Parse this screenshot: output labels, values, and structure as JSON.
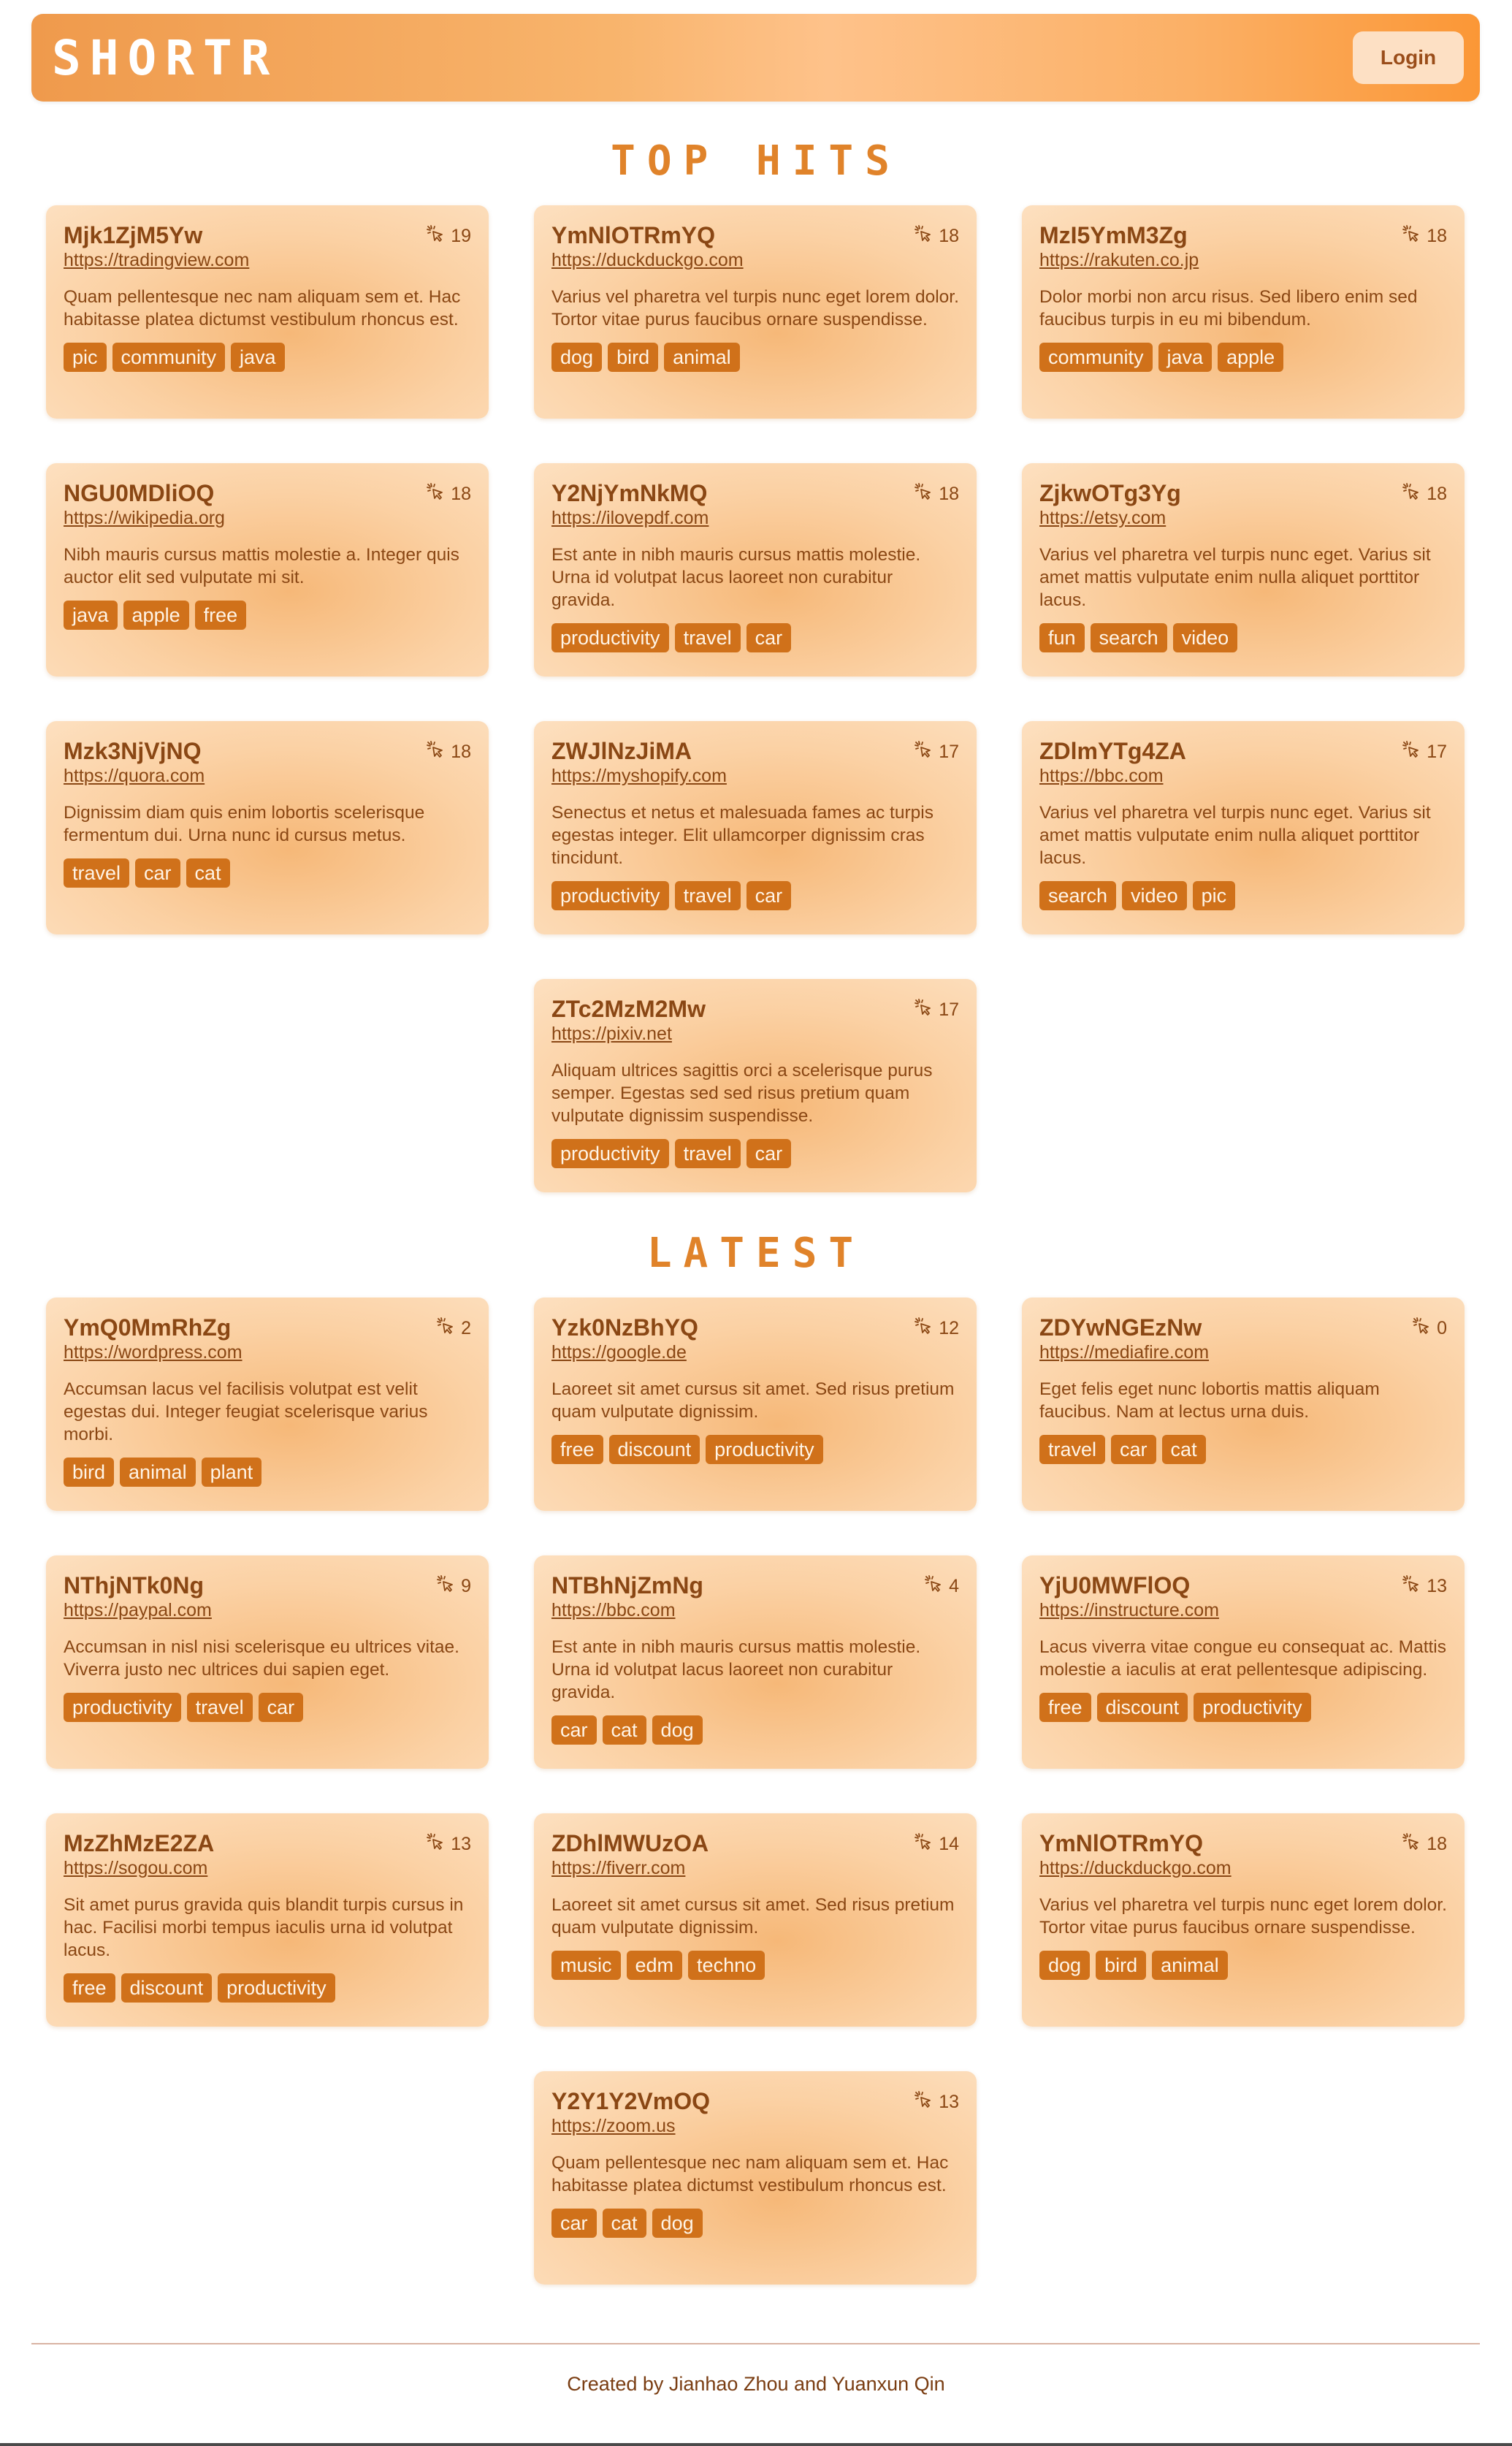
{
  "header": {
    "logo": "SHORTR",
    "login_label": "Login"
  },
  "sections": [
    {
      "title": "TOP HITS",
      "cards": [
        {
          "code": "Mjk1ZjM5Yw",
          "url": "https://tradingview.com",
          "hits": "19",
          "desc": "Quam pellentesque nec nam aliquam sem et. Hac habitasse platea dictumst vestibulum rhoncus est.",
          "tags": [
            "pic",
            "community",
            "java"
          ]
        },
        {
          "code": "YmNlOTRmYQ",
          "url": "https://duckduckgo.com",
          "hits": "18",
          "desc": "Varius vel pharetra vel turpis nunc eget lorem dolor. Tortor vitae purus faucibus ornare suspendisse.",
          "tags": [
            "dog",
            "bird",
            "animal"
          ]
        },
        {
          "code": "MzI5YmM3Zg",
          "url": "https://rakuten.co.jp",
          "hits": "18",
          "desc": "Dolor morbi non arcu risus. Sed libero enim sed faucibus turpis in eu mi bibendum.",
          "tags": [
            "community",
            "java",
            "apple"
          ]
        },
        {
          "code": "NGU0MDliOQ",
          "url": "https://wikipedia.org",
          "hits": "18",
          "desc": "Nibh mauris cursus mattis molestie a. Integer quis auctor elit sed vulputate mi sit.",
          "tags": [
            "java",
            "apple",
            "free"
          ]
        },
        {
          "code": "Y2NjYmNkMQ",
          "url": "https://ilovepdf.com",
          "hits": "18",
          "desc": "Est ante in nibh mauris cursus mattis molestie. Urna id volutpat lacus laoreet non curabitur gravida.",
          "tags": [
            "productivity",
            "travel",
            "car"
          ]
        },
        {
          "code": "ZjkwOTg3Yg",
          "url": "https://etsy.com",
          "hits": "18",
          "desc": "Varius vel pharetra vel turpis nunc eget. Varius sit amet mattis vulputate enim nulla aliquet porttitor lacus.",
          "tags": [
            "fun",
            "search",
            "video"
          ]
        },
        {
          "code": "Mzk3NjVjNQ",
          "url": "https://quora.com",
          "hits": "18",
          "desc": "Dignissim diam quis enim lobortis scelerisque fermentum dui. Urna nunc id cursus metus.",
          "tags": [
            "travel",
            "car",
            "cat"
          ]
        },
        {
          "code": "ZWJlNzJiMA",
          "url": "https://myshopify.com",
          "hits": "17",
          "desc": "Senectus et netus et malesuada fames ac turpis egestas integer. Elit ullamcorper dignissim cras tincidunt.",
          "tags": [
            "productivity",
            "travel",
            "car"
          ]
        },
        {
          "code": "ZDlmYTg4ZA",
          "url": "https://bbc.com",
          "hits": "17",
          "desc": "Varius vel pharetra vel turpis nunc eget. Varius sit amet mattis vulputate enim nulla aliquet porttitor lacus.",
          "tags": [
            "search",
            "video",
            "pic"
          ]
        },
        {
          "code": "ZTc2MzM2Mw",
          "url": "https://pixiv.net",
          "hits": "17",
          "desc": "Aliquam ultrices sagittis orci a scelerisque purus semper. Egestas sed sed risus pretium quam vulputate dignissim suspendisse.",
          "tags": [
            "productivity",
            "travel",
            "car"
          ]
        }
      ]
    },
    {
      "title": "LATEST",
      "cards": [
        {
          "code": "YmQ0MmRhZg",
          "url": "https://wordpress.com",
          "hits": "2",
          "desc": "Accumsan lacus vel facilisis volutpat est velit egestas dui. Integer feugiat scelerisque varius morbi.",
          "tags": [
            "bird",
            "animal",
            "plant"
          ]
        },
        {
          "code": "Yzk0NzBhYQ",
          "url": "https://google.de",
          "hits": "12",
          "desc": "Laoreet sit amet cursus sit amet. Sed risus pretium quam vulputate dignissim.",
          "tags": [
            "free",
            "discount",
            "productivity"
          ]
        },
        {
          "code": "ZDYwNGEzNw",
          "url": "https://mediafire.com",
          "hits": "0",
          "desc": "Eget felis eget nunc lobortis mattis aliquam faucibus. Nam at lectus urna duis.",
          "tags": [
            "travel",
            "car",
            "cat"
          ]
        },
        {
          "code": "NThjNTk0Ng",
          "url": "https://paypal.com",
          "hits": "9",
          "desc": "Accumsan in nisl nisi scelerisque eu ultrices vitae. Viverra justo nec ultrices dui sapien eget.",
          "tags": [
            "productivity",
            "travel",
            "car"
          ]
        },
        {
          "code": "NTBhNjZmNg",
          "url": "https://bbc.com",
          "hits": "4",
          "desc": "Est ante in nibh mauris cursus mattis molestie. Urna id volutpat lacus laoreet non curabitur gravida.",
          "tags": [
            "car",
            "cat",
            "dog"
          ]
        },
        {
          "code": "YjU0MWFlOQ",
          "url": "https://instructure.com",
          "hits": "13",
          "desc": "Lacus viverra vitae congue eu consequat ac. Mattis molestie a iaculis at erat pellentesque adipiscing.",
          "tags": [
            "free",
            "discount",
            "productivity"
          ]
        },
        {
          "code": "MzZhMzE2ZA",
          "url": "https://sogou.com",
          "hits": "13",
          "desc": "Sit amet purus gravida quis blandit turpis cursus in hac. Facilisi morbi tempus iaculis urna id volutpat lacus.",
          "tags": [
            "free",
            "discount",
            "productivity"
          ]
        },
        {
          "code": "ZDhlMWUzOA",
          "url": "https://fiverr.com",
          "hits": "14",
          "desc": "Laoreet sit amet cursus sit amet. Sed risus pretium quam vulputate dignissim.",
          "tags": [
            "music",
            "edm",
            "techno"
          ]
        },
        {
          "code": "YmNlOTRmYQ",
          "url": "https://duckduckgo.com",
          "hits": "18",
          "desc": "Varius vel pharetra vel turpis nunc eget lorem dolor. Tortor vitae purus faucibus ornare suspendisse.",
          "tags": [
            "dog",
            "bird",
            "animal"
          ]
        },
        {
          "code": "Y2Y1Y2VmOQ",
          "url": "https://zoom.us",
          "hits": "13",
          "desc": "Quam pellentesque nec nam aliquam sem et. Hac habitasse platea dictumst vestibulum rhoncus est.",
          "tags": [
            "car",
            "cat",
            "dog"
          ]
        }
      ]
    }
  ],
  "footer": {
    "text": "Created by Jianhao Zhou and Yuanxun Qin"
  },
  "icons": {
    "hits": "click-icon"
  },
  "colors": {
    "accent": "#e0832a",
    "tag": "#d0711a",
    "text": "#8a4714"
  }
}
